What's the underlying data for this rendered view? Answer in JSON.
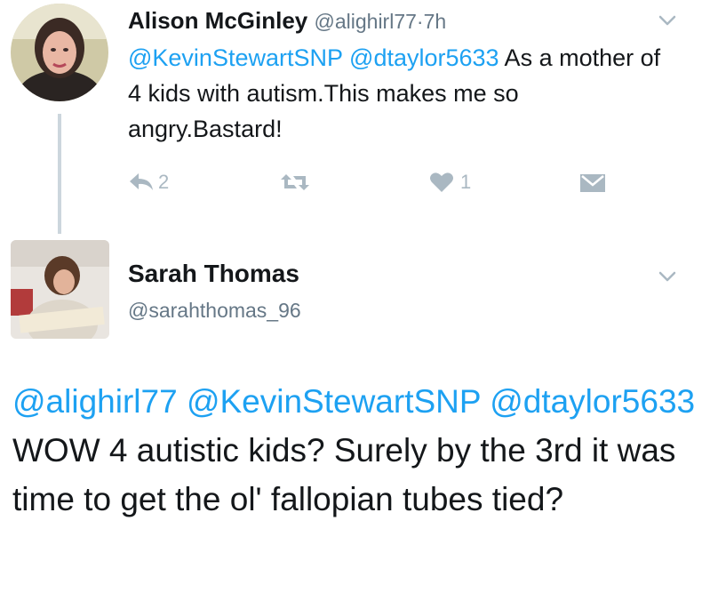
{
  "tweet1": {
    "author_name": "Alison McGinley",
    "author_handle": "@alighirl77",
    "separator": "·",
    "time": "7h",
    "mention1": "@KevinStewartSNP",
    "mention2": "@dtaylor5633",
    "text": " As a mother of 4 kids with autism.This makes me so angry.Bastard!",
    "reply_count": "2",
    "like_count": "1"
  },
  "tweet2": {
    "author_name": "Sarah Thomas",
    "author_handle": "@sarahthomas_96",
    "mention1": "@alighirl77",
    "mention2": "@KevinStewartSNP",
    "mention3": "@dtaylor5633",
    "text": " WOW 4 autistic kids? Surely by the 3rd it was time to get the ol' fallopian tubes tied?"
  },
  "colors": {
    "link": "#1da1f2",
    "muted": "#657786",
    "icon": "#aab8c2",
    "thread_line": "#ccd6dd"
  },
  "icons": [
    "reply-icon",
    "retweet-icon",
    "heart-icon",
    "direct-message-icon",
    "chevron-down-icon"
  ]
}
